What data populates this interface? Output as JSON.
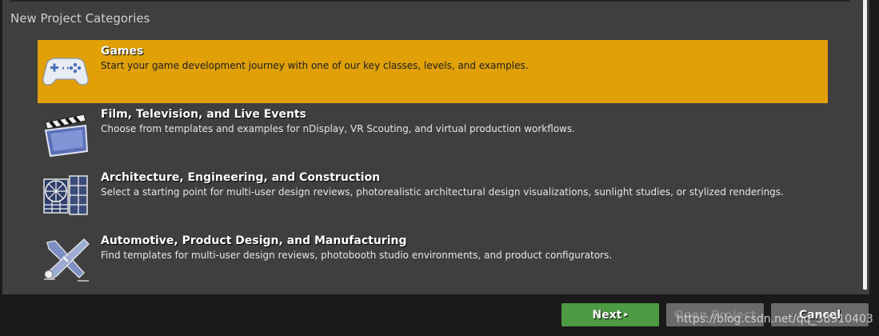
{
  "dialog": {
    "title": "New Project Categories"
  },
  "categories": [
    {
      "title": "Games",
      "description": "Start your game development journey with one of our key classes, levels, and examples.",
      "icon": "gamepad-icon",
      "selected": true
    },
    {
      "title": "Film, Television, and Live Events",
      "description": "Choose from templates and examples for nDisplay, VR Scouting, and virtual production workflows.",
      "icon": "clapperboard-icon",
      "selected": false
    },
    {
      "title": "Architecture, Engineering, and Construction",
      "description": "Select a starting point for multi-user design reviews, photorealistic architectural design visualizations, sunlight studies, or stylized renderings.",
      "icon": "architecture-grid-icon",
      "selected": false
    },
    {
      "title": "Automotive, Product Design, and Manufacturing",
      "description": "Find templates for multi-user design reviews, photobooth studio environments, and product configurators.",
      "icon": "crossed-tools-icon",
      "selected": false
    }
  ],
  "footer": {
    "next_label": "Next",
    "open_label": "Open Project",
    "cancel_label": "Cancel"
  },
  "watermark": "https://blog.csdn.net/qq_38910403",
  "colors": {
    "selected": "#e0a006",
    "panel": "#3f3f3f",
    "next_button": "#4d9a44"
  }
}
